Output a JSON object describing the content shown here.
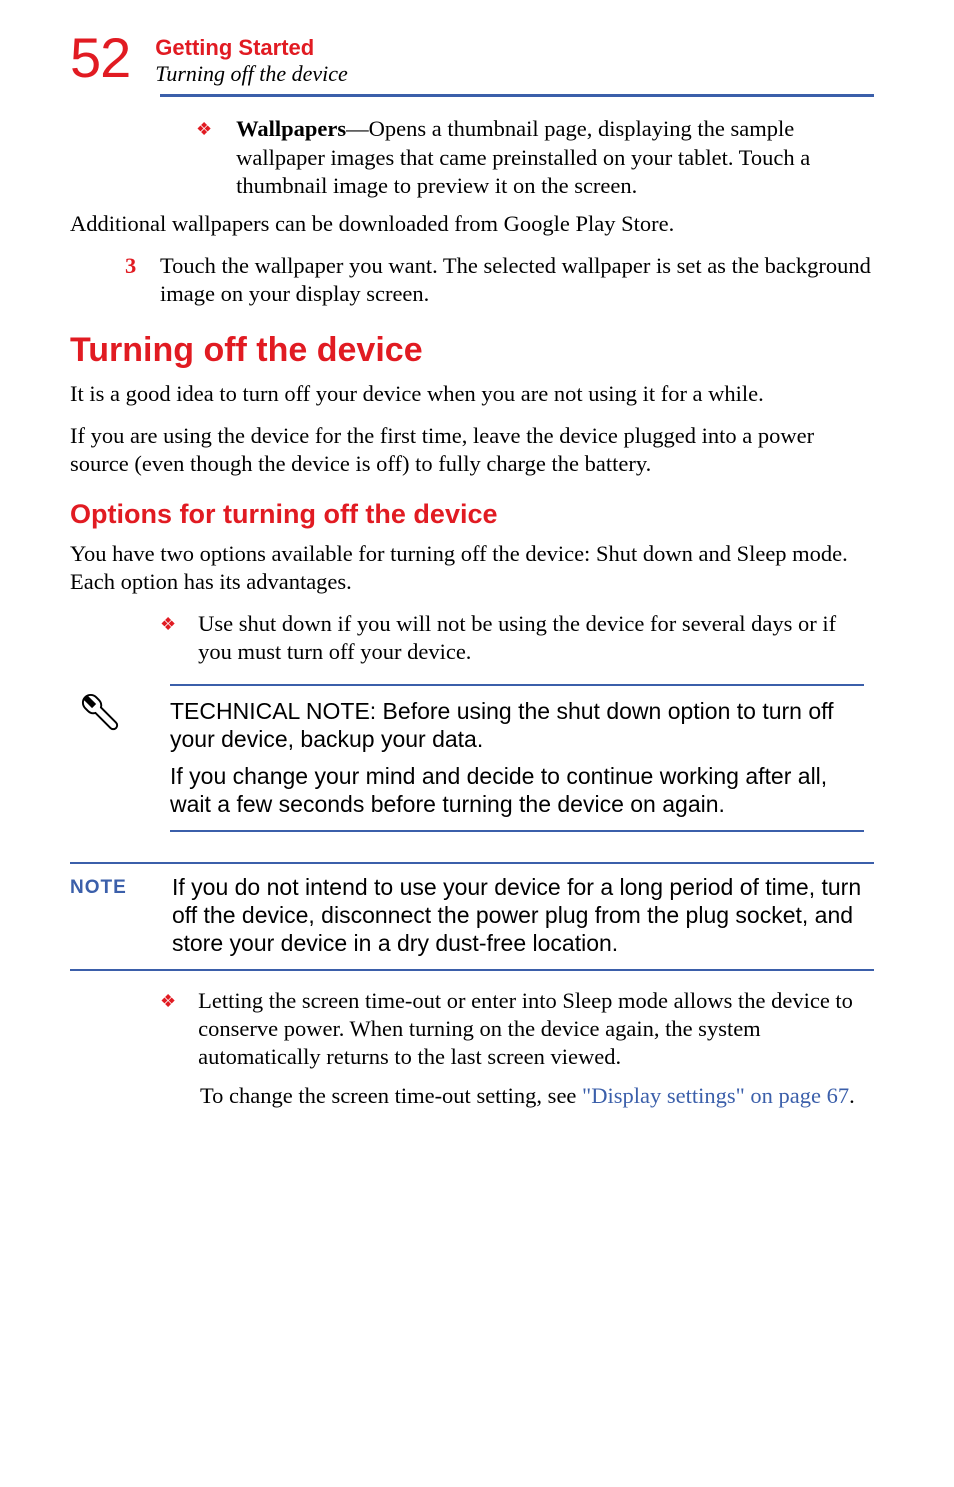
{
  "header": {
    "pageNumber": "52",
    "chapter": "Getting Started",
    "section": "Turning off the device"
  },
  "wallpapers": {
    "label": "Wallpapers",
    "desc": "—Opens a thumbnail page, displaying the sample wallpaper images that came preinstalled on your tablet. Touch a thumbnail image to preview it on the screen."
  },
  "additional": "Additional wallpapers can be downloaded from Google Play Store.",
  "step3": {
    "num": "3",
    "text": "Touch the wallpaper you want. The selected wallpaper is set as the background image on your display screen."
  },
  "h1": "Turning off the device",
  "p1": "It is a good idea to turn off your device when you are not using it for a while.",
  "p2": "If you are using the device for the first time, leave the device plugged into a power source (even though the device is off) to fully charge the battery.",
  "h2": "Options for turning off the device",
  "p3": "You have two options available for turning off the device: Shut down and Sleep mode. Each option has its advantages.",
  "bullet_shutdown": "Use shut down if you will not be using the device for several days or if you must turn off your device.",
  "technote": {
    "p1": "TECHNICAL NOTE: Before using the shut down option to turn off your device, backup your data.",
    "p2": "If you change your mind and decide to continue working after all, wait a few seconds before turning the device on again."
  },
  "note": {
    "label": "NOTE",
    "text": "If you do not intend to use your device for a long period of time, turn off the device, disconnect the power plug from the plug socket, and store your device in a dry dust-free location."
  },
  "bullet_sleep": "Letting the screen time-out or enter into Sleep mode allows the device to conserve power. When turning on the device again, the system automatically returns to the last screen viewed.",
  "timeout_prefix": "To change the screen time-out setting, see ",
  "timeout_link": "\"Display settings\" on page 67",
  "timeout_suffix": "."
}
